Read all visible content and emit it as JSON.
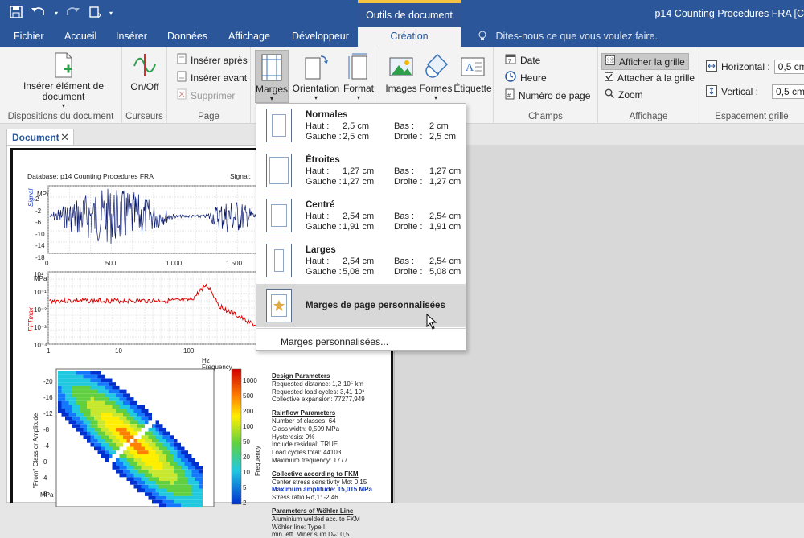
{
  "window": {
    "title": "p14 Counting Procedures FRA [C",
    "context_tab": "Outils de document"
  },
  "tabs": [
    {
      "label": "Fichier"
    },
    {
      "label": "Accueil"
    },
    {
      "label": "Insérer"
    },
    {
      "label": "Données"
    },
    {
      "label": "Affichage"
    },
    {
      "label": "Développeur"
    },
    {
      "label": "Création"
    }
  ],
  "tellme": "Dites-nous ce que vous voulez faire.",
  "ribbon": {
    "g1": {
      "btn": "Insérer élément de document",
      "label": "Dispositions du document"
    },
    "g2": {
      "btn": "On/Off",
      "label": "Curseurs"
    },
    "g3": {
      "after": "Insérer après",
      "before": "Insérer avant",
      "delete": "Supprimer",
      "label": "Page"
    },
    "g4": {
      "margins": "Marges",
      "orientation": "Orientation",
      "format": "Format"
    },
    "g5": {
      "images": "Images",
      "shapes": "Formes",
      "label_btn": "Étiquette"
    },
    "g6": {
      "date": "Date",
      "time": "Heure",
      "page_num": "Numéro de page",
      "label": "Champs"
    },
    "g7": {
      "grid": "Afficher la grille",
      "snap": "Attacher à la grille",
      "zoom": "Zoom",
      "label": "Affichage"
    },
    "g8": {
      "h_label": "Horizontal :",
      "h_val": "0,5 cm",
      "v_label": "Vertical :",
      "v_val": "0,5 cm",
      "label": "Espacement grille"
    }
  },
  "document": {
    "tab": "Document",
    "header_db": "Database: p14 Counting Procedures FRA",
    "header_sig": "Signal:",
    "chart1": {
      "ylabel": "Signal",
      "unit": "MPa",
      "yticks": [
        "2",
        "-2",
        "-6",
        "-10",
        "-14",
        "-18"
      ],
      "xticks": [
        "0",
        "500",
        "1 000",
        "1 500"
      ]
    },
    "chart2": {
      "ylabel": "FFTmax",
      "unit": "MPa",
      "xlabel": "Frequency",
      "xunit": "Hz",
      "xticks": [
        "1",
        "10",
        "100"
      ],
      "yticks": [
        "10¹",
        "10⁻¹",
        "10⁻²",
        "10⁻³",
        "10⁻⁴"
      ]
    },
    "chart3": {
      "ylabel": "\"From\" Class or Amplitude",
      "unit": "MPa",
      "yticks": [
        "-20",
        "-16",
        "-12",
        "-8",
        "-4",
        "0",
        "4",
        "8"
      ],
      "cbar_label": "Frequency",
      "cbar_ticks": [
        "1000",
        "500",
        "200",
        "100",
        "50",
        "20",
        "10",
        "5",
        "2"
      ]
    },
    "params": [
      {
        "text": "Design Parameters",
        "style": "b"
      },
      {
        "text": "Requested distance: 1,2·10⁵ km",
        "style": ""
      },
      {
        "text": "Requested load cycles: 3,41·10⁹",
        "style": ""
      },
      {
        "text": "Collective expansion: 77277,949",
        "style": ""
      },
      {
        "text": "Rainflow Parameters",
        "style": "b"
      },
      {
        "text": "Number of classes: 64",
        "style": ""
      },
      {
        "text": "Class width: 0,509 MPa",
        "style": ""
      },
      {
        "text": "Hysteresis: 0%",
        "style": ""
      },
      {
        "text": "Include residual: TRUE",
        "style": ""
      },
      {
        "text": "Load cycles total: 44103",
        "style": ""
      },
      {
        "text": "Maximum frequency: 1777",
        "style": ""
      },
      {
        "text": "Collective according to FKM",
        "style": "b"
      },
      {
        "text": "Center stress sensitivity Mσ: 0,15",
        "style": ""
      },
      {
        "text": "Maximum amplitude: 15,015 MPa",
        "style": "blue"
      },
      {
        "text": "Stress ratio Rσ,1: -2,46",
        "style": ""
      },
      {
        "text": "Parameters of Wöhler Line",
        "style": "b"
      },
      {
        "text": "Aluminium welded acc. to FKM",
        "style": ""
      },
      {
        "text": "Wöhler line: Type I",
        "style": ""
      },
      {
        "text": "min. eff. Miner sum Dₘ: 0,5",
        "style": ""
      }
    ]
  },
  "margins_menu": {
    "items": [
      {
        "title": "Normales",
        "top_label": "Haut :",
        "top": "2,5 cm",
        "bottom_label": "Bas :",
        "bottom": "2 cm",
        "left_label": "Gauche :",
        "left": "2,5 cm",
        "right_label": "Droite :",
        "right": "2,5 cm"
      },
      {
        "title": "Étroites",
        "top_label": "Haut :",
        "top": "1,27 cm",
        "bottom_label": "Bas :",
        "bottom": "1,27 cm",
        "left_label": "Gauche :",
        "left": "1,27 cm",
        "right_label": "Droite :",
        "right": "1,27 cm"
      },
      {
        "title": "Centré",
        "top_label": "Haut :",
        "top": "2,54 cm",
        "bottom_label": "Bas :",
        "bottom": "2,54 cm",
        "left_label": "Gauche :",
        "left": "1,91 cm",
        "right_label": "Droite :",
        "right": "1,91 cm"
      },
      {
        "title": "Larges",
        "top_label": "Haut :",
        "top": "2,54 cm",
        "bottom_label": "Bas :",
        "bottom": "2,54 cm",
        "left_label": "Gauche :",
        "left": "5,08 cm",
        "right_label": "Droite :",
        "right": "5,08 cm"
      }
    ],
    "custom_item": "Marges de page personnalisées",
    "custom_link": "Marges personnalisées..."
  },
  "colors": {
    "accent": "#2b579a",
    "context": "#f5c242",
    "signal": "#0a1a6e",
    "fft": "#e00000"
  }
}
